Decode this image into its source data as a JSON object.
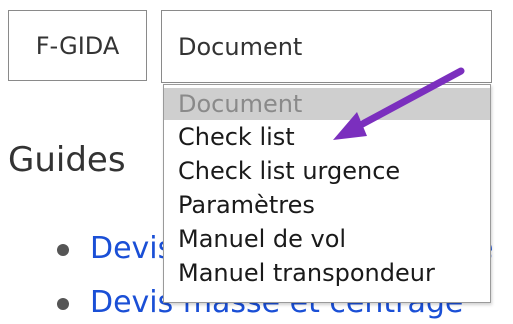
{
  "toolbar": {
    "code_label": "F-GIDA",
    "select_value": "Document"
  },
  "main": {
    "heading": "Guides",
    "guides": [
      {
        "label": "Devis de poids et centrage"
      },
      {
        "label": "Devis masse et centrage"
      }
    ]
  },
  "dropdown": {
    "options": [
      {
        "label": "Document",
        "disabled": true
      },
      {
        "label": "Check list"
      },
      {
        "label": "Check list urgence"
      },
      {
        "label": "Paramètres"
      },
      {
        "label": "Manuel de vol"
      },
      {
        "label": "Manuel transpondeur"
      }
    ]
  },
  "annotation": {
    "arrow_color": "#7b2fbe",
    "arrow_target": "Check list"
  }
}
